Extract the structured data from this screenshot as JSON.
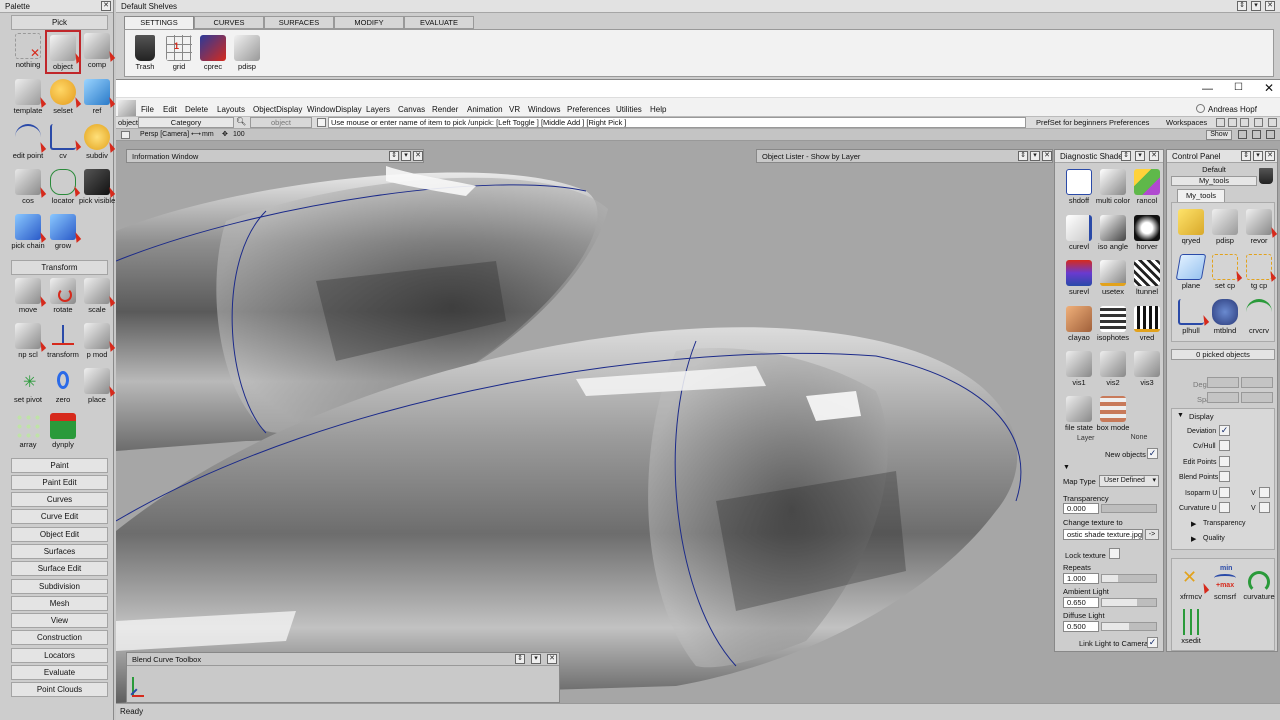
{
  "palette": {
    "title": "Palette",
    "pick_header": "Pick",
    "pick_tools": [
      {
        "label": "nothing",
        "icon": "nothing-icon"
      },
      {
        "label": "object",
        "icon": "pick-object-icon"
      },
      {
        "label": "comp",
        "icon": "pick-component-icon"
      },
      {
        "label": "template",
        "icon": "template-icon"
      },
      {
        "label": "selset",
        "icon": "selection-set-icon"
      },
      {
        "label": "ref",
        "icon": "reference-icon"
      },
      {
        "label": "edit point",
        "icon": "edit-point-icon"
      },
      {
        "label": "cv",
        "icon": "cv-icon"
      },
      {
        "label": "subdiv",
        "icon": "subdiv-icon"
      },
      {
        "label": "cos",
        "icon": "cos-icon"
      },
      {
        "label": "locator",
        "icon": "locator-icon"
      },
      {
        "label": "pick visible",
        "icon": "pick-visible-icon"
      },
      {
        "label": "pick chain",
        "icon": "pick-chain-icon"
      },
      {
        "label": "grow",
        "icon": "grow-icon"
      }
    ],
    "transform_header": "Transform",
    "transform_tools": [
      {
        "label": "move",
        "icon": "move-icon"
      },
      {
        "label": "rotate",
        "icon": "rotate-icon"
      },
      {
        "label": "scale",
        "icon": "scale-icon"
      },
      {
        "label": "np scl",
        "icon": "nonproportional-scale-icon"
      },
      {
        "label": "transform",
        "icon": "transform-icon"
      },
      {
        "label": "p mod",
        "icon": "pivot-modify-icon"
      },
      {
        "label": "set pivot",
        "icon": "set-pivot-icon"
      },
      {
        "label": "zero",
        "icon": "zero-icon"
      },
      {
        "label": "place",
        "icon": "place-icon"
      },
      {
        "label": "array",
        "icon": "array-icon"
      },
      {
        "label": "dynply",
        "icon": "dynamic-placement-icon"
      }
    ],
    "sections": [
      "Paint",
      "Paint Edit",
      "Curves",
      "Curve Edit",
      "Object Edit",
      "Surfaces",
      "Surface Edit",
      "Subdivision",
      "Mesh",
      "View",
      "Construction",
      "Locators",
      "Evaluate",
      "Point Clouds"
    ]
  },
  "shelves": {
    "title": "Default Shelves",
    "tabs": [
      "SETTINGS",
      "CURVES",
      "SURFACES",
      "MODIFY",
      "EVALUATE"
    ],
    "tools": [
      {
        "label": "Trash",
        "icon": "trash-icon"
      },
      {
        "label": "grid",
        "icon": "grid-icon"
      },
      {
        "label": "cprec",
        "icon": "cprec-icon"
      },
      {
        "label": "pdisp",
        "icon": "pdisp-icon"
      }
    ]
  },
  "menubar": {
    "items": [
      "File",
      "Edit",
      "Delete",
      "Layouts",
      "ObjectDisplay",
      "WindowDisplay",
      "Layers",
      "Canvas",
      "Render",
      "Animation",
      "VR",
      "Windows",
      "Preferences",
      "Utilities",
      "Help"
    ],
    "user": "Andreas Hopf"
  },
  "toolbar": {
    "object_label": "object",
    "category_label": "Category",
    "object_field": "object",
    "prompt": "Use mouse or enter name of item to pick /unpick: [Left Toggle ] [Middle Add ] [Right Pick ]",
    "prefset": "PrefSet for beginners Preferences",
    "workspaces": "Workspaces",
    "show": "Show"
  },
  "viewport": {
    "camera_label": "Persp [Camera]",
    "units": "mm",
    "zoom": "100"
  },
  "info_window": {
    "title": "Information Window"
  },
  "object_lister": {
    "title": "Object Lister - Show by Layer"
  },
  "blend_toolbox": {
    "title": "Blend Curve Toolbox"
  },
  "diagnostic_shade": {
    "title": "Diagnostic Shade",
    "tools": [
      {
        "label": "shdoff",
        "icon": "shade-off-icon"
      },
      {
        "label": "multi color",
        "icon": "multi-color-icon"
      },
      {
        "label": "rancol",
        "icon": "random-color-icon"
      },
      {
        "label": "curevl",
        "icon": "curvature-eval-icon"
      },
      {
        "label": "iso angle",
        "icon": "iso-angle-icon"
      },
      {
        "label": "horver",
        "icon": "horizontal-vertical-icon"
      },
      {
        "label": "surevl",
        "icon": "surface-eval-icon"
      },
      {
        "label": "usetex",
        "icon": "use-texture-icon"
      },
      {
        "label": "ltunnel",
        "icon": "light-tunnel-icon"
      },
      {
        "label": "clayao",
        "icon": "clay-ao-icon"
      },
      {
        "label": "isophotes",
        "icon": "isophotes-icon"
      },
      {
        "label": "vred",
        "icon": "vred-icon"
      },
      {
        "label": "vis1",
        "icon": "vis1-icon"
      },
      {
        "label": "vis2",
        "icon": "vis2-icon"
      },
      {
        "label": "vis3",
        "icon": "vis3-icon"
      },
      {
        "label": "file state",
        "icon": "file-state-icon"
      },
      {
        "label": "box mode",
        "icon": "box-mode-icon"
      }
    ],
    "layer_label": "Layer",
    "layer_value": "None",
    "new_objects": "New objects",
    "map_type_label": "Map Type",
    "map_type_value": "User Defined",
    "transparency_label": "Transparency",
    "transparency_value": "0.000",
    "transparency_fraction": 0,
    "change_texture_label": "Change texture to",
    "texture_value": "ostic shade texture.jpg",
    "texture_btn": "->",
    "lock_texture": "Lock texture",
    "repeats_label": "Repeats",
    "repeats_value": "1.000",
    "repeats_fraction": 0.3,
    "ambient_label": "Ambient Light",
    "ambient_value": "0.650",
    "ambient_fraction": 0.65,
    "diffuse_label": "Diffuse Light",
    "diffuse_value": "0.500",
    "diffuse_fraction": 0.5,
    "link_light": "Link Light to Camera"
  },
  "control_panel": {
    "title": "Control Panel",
    "preset": "Default",
    "tools_dropdown": "My_tools",
    "tab": "My_tools",
    "tools": [
      {
        "label": "qryed",
        "icon": "query-edit-icon"
      },
      {
        "label": "pdisp",
        "icon": "pdisp-icon"
      },
      {
        "label": "revor",
        "icon": "revolve-icon"
      },
      {
        "label": "plane",
        "icon": "plane-icon"
      },
      {
        "label": "set cp",
        "icon": "set-cp-icon"
      },
      {
        "label": "tg cp",
        "icon": "tangent-cp-icon"
      },
      {
        "label": "plhull",
        "icon": "plhull-icon"
      },
      {
        "label": "mtblnd",
        "icon": "multi-blend-icon"
      },
      {
        "label": "crvcrv",
        "icon": "curve-curve-icon"
      }
    ],
    "picked": "0 picked objects",
    "degree_label": "Degree",
    "spans_label": "Spans",
    "display_header": "Display",
    "display_rows": [
      {
        "label": "Deviation",
        "checked": true
      },
      {
        "label": "Cv/Hull",
        "checked": false
      },
      {
        "label": "Edit Points",
        "checked": false
      },
      {
        "label": "Blend Points",
        "checked": false
      },
      {
        "label": "Isoparm U",
        "checked": false
      },
      {
        "label": "Curvature U",
        "checked": false
      }
    ],
    "v_label": "V",
    "transparency_sub": "Transparency",
    "quality_sub": "Quality",
    "bottom_tools": [
      {
        "label": "xfrmcv",
        "icon": "transform-cv-icon"
      },
      {
        "label": "scmsrf",
        "icon": "scale-max-icon"
      },
      {
        "label": "curvature",
        "icon": "curvature-icon"
      },
      {
        "label": "xsedit",
        "icon": "cross-section-edit-icon"
      }
    ],
    "scm_min": "min",
    "scm_max": "+max"
  },
  "status": {
    "text": "Ready"
  },
  "colors": {
    "accent_red": "#d62a1c",
    "selected_outline": "#c0262a",
    "curve_blue": "#1b2a8a",
    "panel_bg": "#c8c8c8",
    "viewport_bg": "#a6a6a6"
  }
}
